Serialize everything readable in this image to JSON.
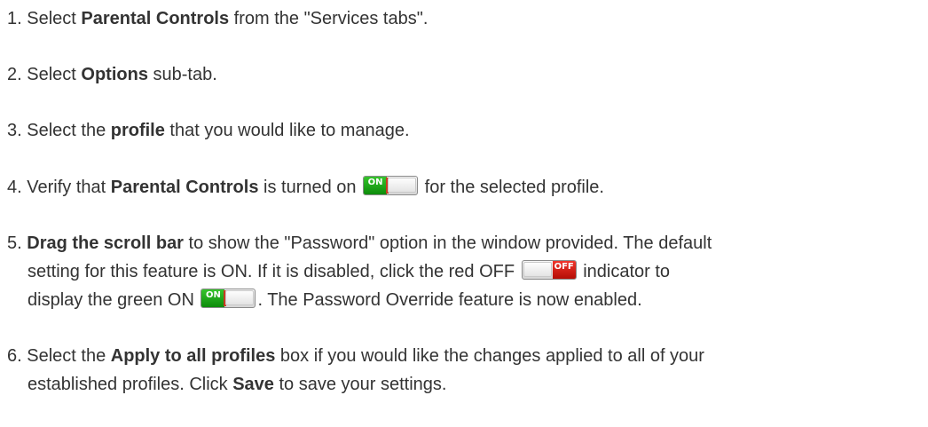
{
  "steps": [
    {
      "num": "1.",
      "pre": " Select ",
      "bold": "Parental Controls",
      "post": " from the \"Services tabs\"."
    },
    {
      "num": "2.",
      "pre": " Select ",
      "bold": "Options",
      "post": " sub-tab."
    },
    {
      "num": "3.",
      "pre": " Select the ",
      "bold": "profile",
      "post": " that you would like to manage."
    },
    {
      "num": "4.",
      "pre": " Verify that ",
      "bold": "Parental Controls",
      "mid": " is turned on ",
      "post": " for the selected profile."
    },
    {
      "num": "5.",
      "bold": "Drag the scroll bar",
      "line1_post": " to show the \"Password\" option in the window provided. The default",
      "line2_pre": "setting for this feature is ON. If it is disabled, click the red OFF ",
      "line2_post": " indicator to",
      "line3_pre": "display the green ON ",
      "line3_post": ". The Password Override feature is now enabled."
    },
    {
      "num": "6.",
      "pre": " Select the ",
      "bold": "Apply to all profiles",
      "line1_post": " box if you would like the changes applied to all of your",
      "line2_pre": "established profiles. Click ",
      "bold2": "Save",
      "line2_post": " to save your settings."
    }
  ],
  "toggles": {
    "on_label": "ON",
    "off_label": "OFF",
    "on_color": "#1aa316",
    "off_color": "#d8170c"
  }
}
